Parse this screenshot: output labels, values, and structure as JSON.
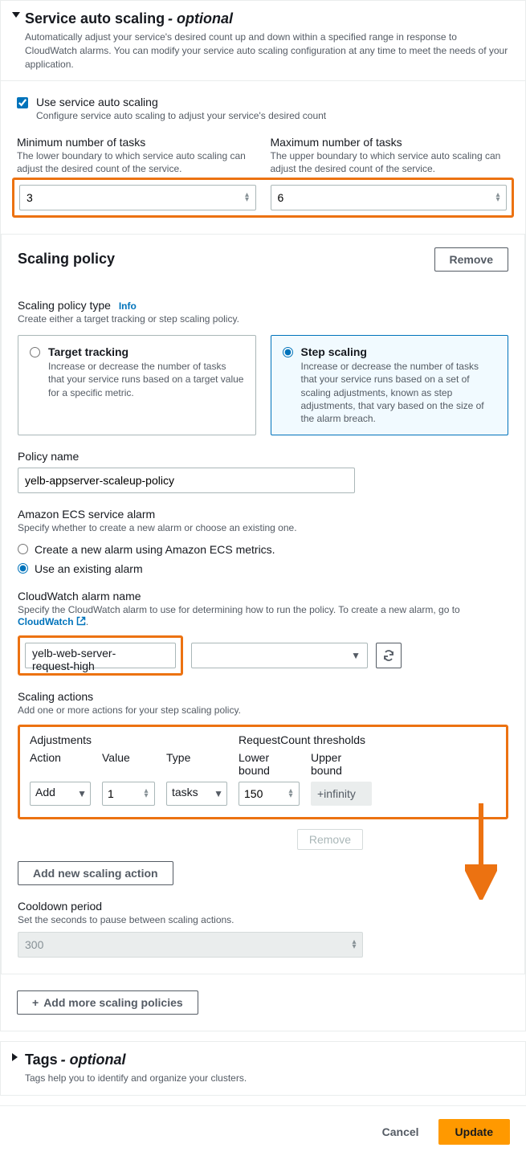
{
  "autoScaling": {
    "title": "Service auto scaling",
    "optional": "- optional",
    "desc": "Automatically adjust your service's desired count up and down within a specified range in response to CloudWatch alarms. You can modify your service auto scaling configuration at any time to meet the needs of your application.",
    "checkbox": {
      "label": "Use service auto scaling",
      "desc": "Configure service auto scaling to adjust your service's desired count"
    },
    "minTasks": {
      "label": "Minimum number of tasks",
      "desc": "The lower boundary to which service auto scaling can adjust the desired count of the service.",
      "value": "3"
    },
    "maxTasks": {
      "label": "Maximum number of tasks",
      "desc": "The upper boundary to which service auto scaling can adjust the desired count of the service.",
      "value": "6"
    }
  },
  "scalingPolicy": {
    "title": "Scaling policy",
    "removeBtn": "Remove",
    "typeLabel": "Scaling policy type",
    "infoLabel": "Info",
    "typeDesc": "Create either a target tracking or step scaling policy.",
    "targetTracking": {
      "title": "Target tracking",
      "desc": "Increase or decrease the number of tasks that your service runs based on a target value for a specific metric."
    },
    "stepScaling": {
      "title": "Step scaling",
      "desc": "Increase or decrease the number of tasks that your service runs based on a set of scaling adjustments, known as step adjustments, that vary based on the size of the alarm breach."
    },
    "policyName": {
      "label": "Policy name",
      "value": "yelb-appserver-scaleup-policy"
    },
    "ecsAlarm": {
      "label": "Amazon ECS service alarm",
      "desc": "Specify whether to create a new alarm or choose an existing one.",
      "optCreate": "Create a new alarm using Amazon ECS metrics.",
      "optExisting": "Use an existing alarm"
    },
    "cwAlarm": {
      "label": "CloudWatch alarm name",
      "descPrefix": "Specify the CloudWatch alarm to use for determining how to run the policy. To create a new alarm, go to ",
      "linkText": "CloudWatch",
      "descSuffix": ".",
      "value": "yelb-web-server-request-high"
    },
    "scalingActions": {
      "label": "Scaling actions",
      "desc": "Add one or more actions for your step scaling policy."
    },
    "adjustments": {
      "adjHeader": "Adjustments",
      "thresholdHeader": "RequestCount thresholds",
      "actionLabel": "Action",
      "valueLabel": "Value",
      "typeLabel": "Type",
      "lowerLabel": "Lower bound",
      "upperLabel": "Upper bound",
      "action": "Add",
      "value": "1",
      "type": "tasks",
      "lower": "150",
      "upper": "+infinity"
    },
    "removeAction": "Remove",
    "addAction": "Add new scaling action",
    "cooldown": {
      "label": "Cooldown period",
      "desc": "Set the seconds to pause between scaling actions.",
      "value": "300"
    }
  },
  "addMorePolicies": "Add more scaling policies",
  "tags": {
    "title": "Tags",
    "optional": "- optional",
    "desc": "Tags help you to identify and organize your clusters."
  },
  "footer": {
    "cancel": "Cancel",
    "update": "Update"
  }
}
